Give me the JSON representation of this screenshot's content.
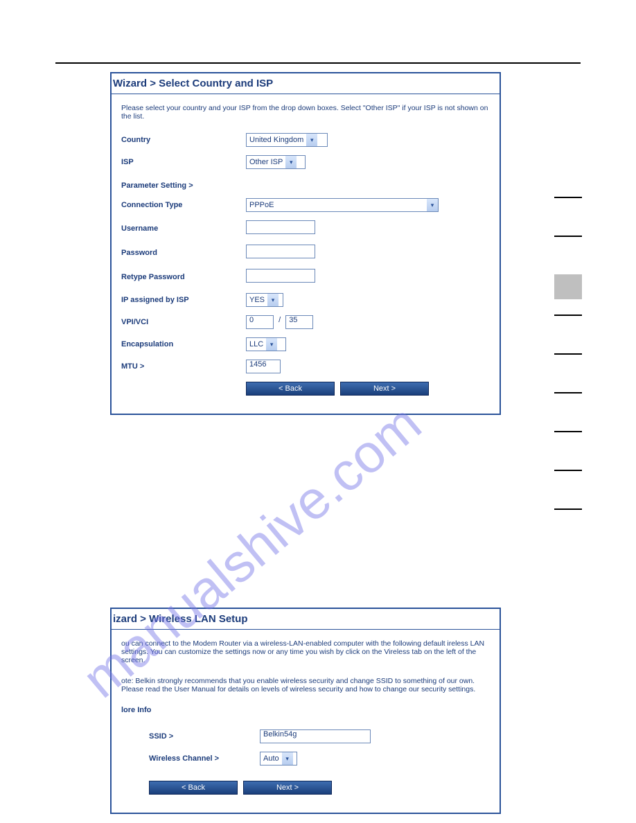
{
  "watermark": "manualshive.com",
  "panel1": {
    "title": "Wizard > Select Country and ISP",
    "instruction": "Please select your country and your ISP from the drop down boxes. Select \"Other ISP\" if your ISP is not shown on the list.",
    "fields": {
      "country_label": "Country",
      "country_value": "United Kingdom",
      "isp_label": "ISP",
      "isp_value": "Other ISP",
      "param_heading": "Parameter Setting >",
      "conn_label": "Connection Type",
      "conn_value": "PPPoE",
      "user_label": "Username",
      "user_value": "",
      "pass_label": "Password",
      "pass_value": "",
      "repass_label": "Retype Password",
      "repass_value": "",
      "ipisp_label": "IP assigned by ISP",
      "ipisp_value": "YES",
      "vpi_label": "VPI/VCI",
      "vpi_value": "0",
      "vpi_sep": "/",
      "vci_value": "35",
      "encap_label": "Encapsulation",
      "encap_value": "LLC",
      "mtu_label": "MTU >",
      "mtu_value": "1456"
    },
    "buttons": {
      "back": "< Back",
      "next": "Next >"
    }
  },
  "panel2": {
    "title": "izard > Wireless LAN Setup",
    "instruction_lines": [
      "ou can connect to the Modem Router via a wireless-LAN-enabled computer with the following default ireless LAN settings. You can customize the settings now or any time you wish by click on the Vireless tab on the left of the screen.",
      "ote: Belkin strongly recommends that you enable wireless security and change SSID to something of our own. Please read the User Manual for details on levels of wireless security and how to change our security settings."
    ],
    "more_info": "lore Info",
    "fields": {
      "ssid_label": "SSID >",
      "ssid_value": "Belkin54g",
      "chan_label": "Wireless Channel >",
      "chan_value": "Auto"
    },
    "buttons": {
      "back": "< Back",
      "next": "Next >"
    }
  }
}
